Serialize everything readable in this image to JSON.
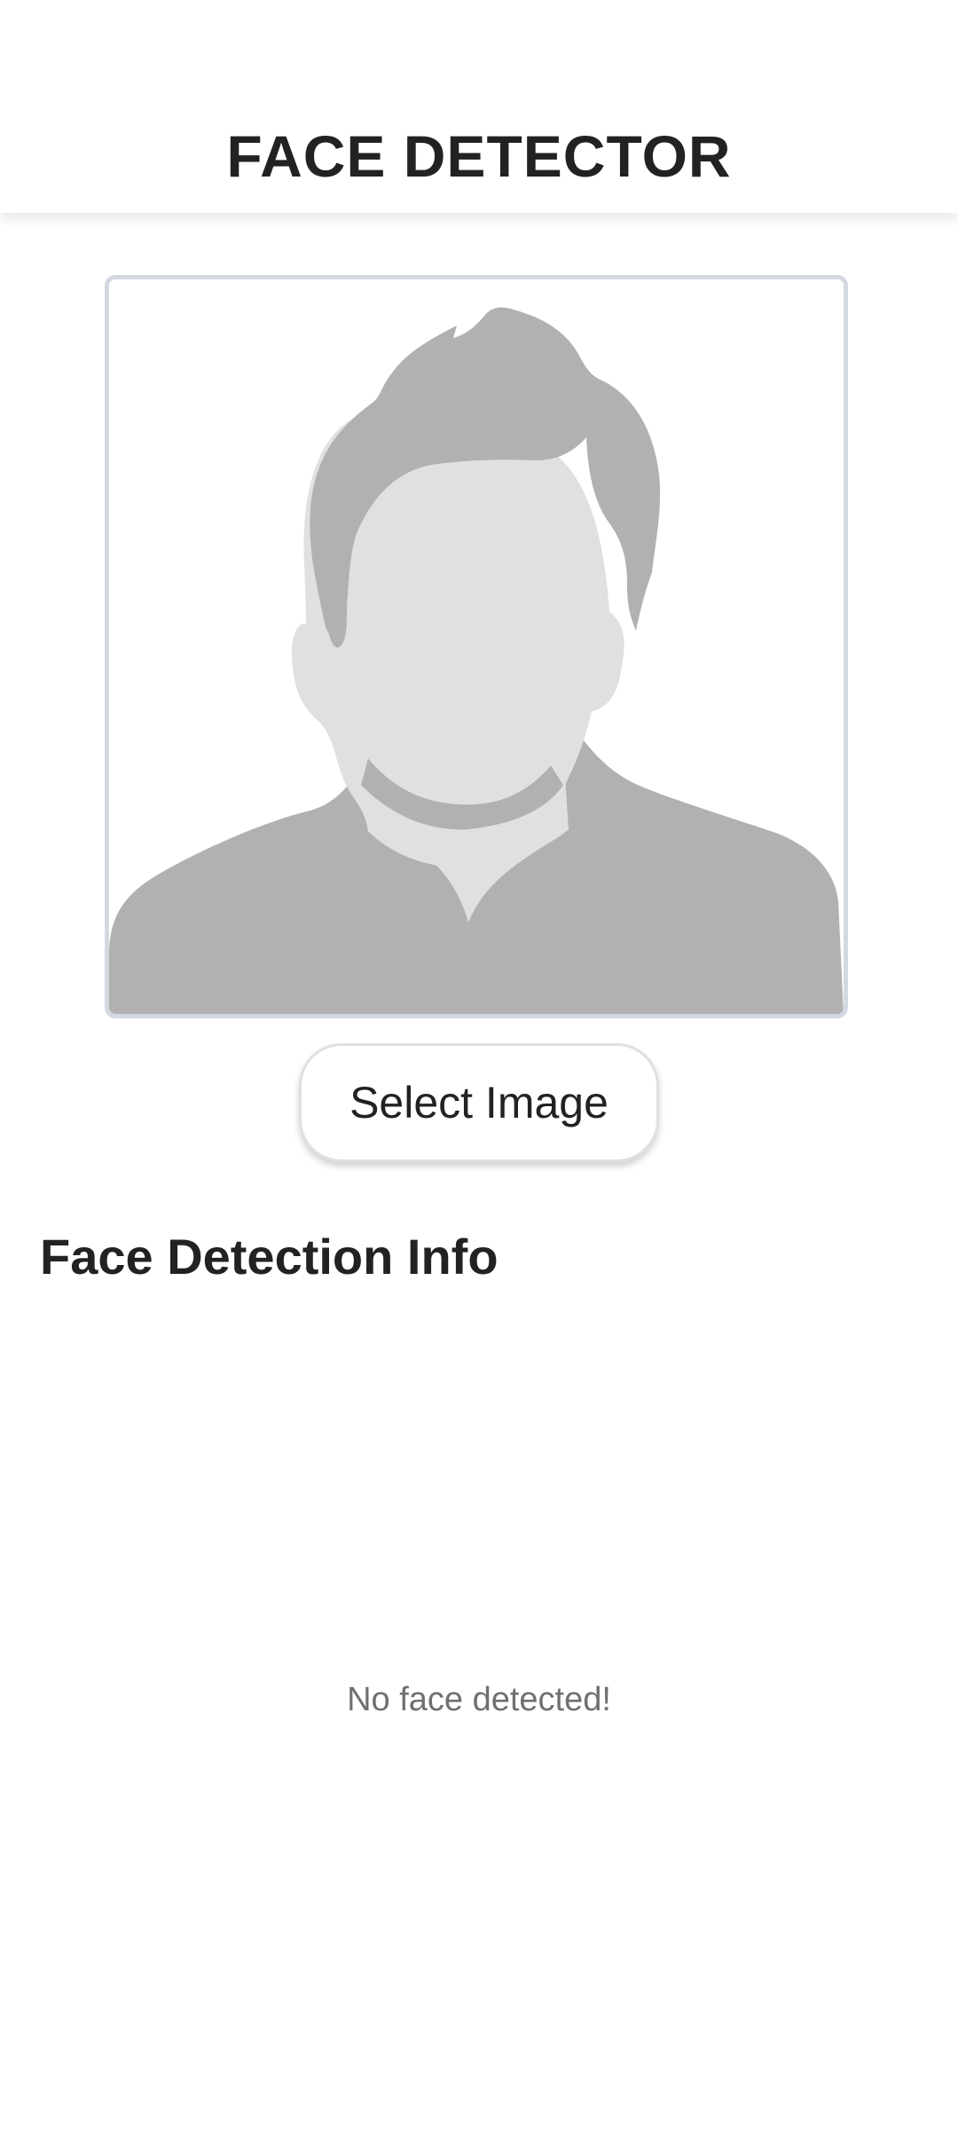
{
  "app_bar": {
    "title": "FACE DETECTOR"
  },
  "image_preview": {
    "icon": "person-placeholder-icon"
  },
  "actions": {
    "select_image_label": "Select Image"
  },
  "detection_info": {
    "heading": "Face Detection Info",
    "status_message": "No face detected!"
  },
  "colors": {
    "frame_border": "#d3d9e2",
    "silhouette_dark": "#b1b1b1",
    "silhouette_light": "#e0e0df",
    "text_primary": "#222222",
    "text_secondary": "#707070"
  }
}
